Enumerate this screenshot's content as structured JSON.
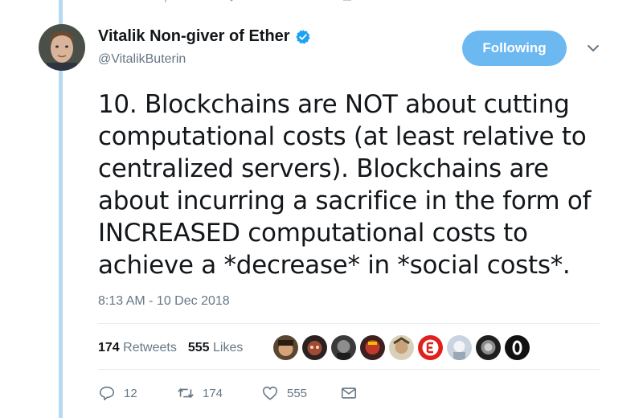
{
  "tweet": {
    "display_name": "Vitalik Non-giver of Ether",
    "handle": "@VitalikButerin",
    "follow_label": "Following",
    "text": "10. Blockchains are NOT about cutting\ncomputational costs (at least relative to\ncentralized servers). Blockchains are\nabout incurring a sacrifice in the form of\nINCREASED computational costs to\nachieve a *decrease* in *social costs*.",
    "timestamp": "8:13 AM - 10 Dec 2018",
    "retweets_count": "174",
    "retweets_label": "Retweets",
    "likes_count": "555",
    "likes_label": "Likes",
    "reply_count": "12",
    "retweet_action_count": "174",
    "like_action_count": "555"
  },
  "colors": {
    "accent": "#1da1f2",
    "follow_button": "#6cb8f0",
    "thread_line": "#b6d9f2",
    "muted_text": "#657786"
  },
  "icons": [
    "verified-badge-icon",
    "chevron-down-icon",
    "reply-icon",
    "retweet-icon",
    "like-icon",
    "message-icon"
  ]
}
